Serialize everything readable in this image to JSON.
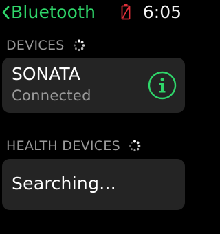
{
  "header": {
    "back_label": "Bluetooth",
    "back_icon": "chevron-left-icon",
    "battery_icon": "battery-low-icon",
    "time": "6:05"
  },
  "sections": {
    "devices": {
      "label": "DEVICES",
      "spinner_icon": "loading-spinner-icon",
      "items": [
        {
          "name": "SONATA",
          "status": "Connected",
          "action_icon": "info-icon"
        }
      ]
    },
    "health_devices": {
      "label": "HEALTH DEVICES",
      "spinner_icon": "loading-spinner-icon",
      "status_text": "Searching..."
    }
  },
  "colors": {
    "accent": "#2fd66a",
    "battery_warning": "#e0303a",
    "card_background": "#242424",
    "secondary_text": "#9a9a9a"
  }
}
